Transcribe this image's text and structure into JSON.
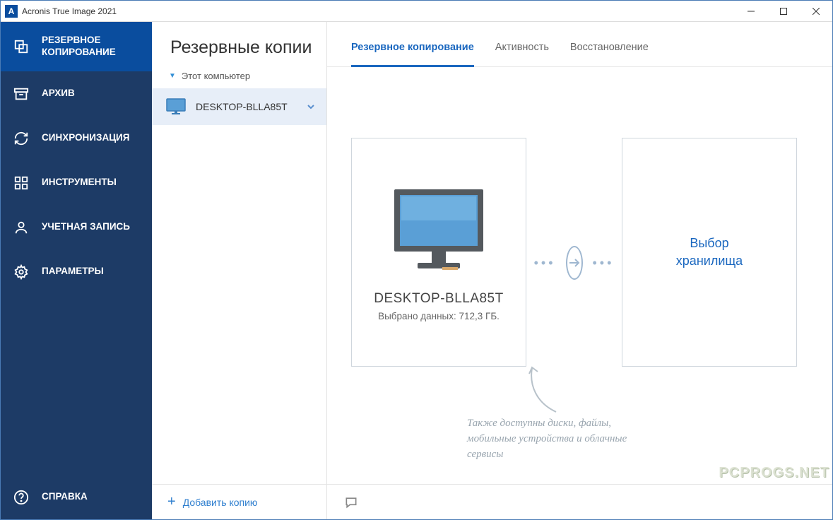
{
  "title": "Acronis True Image 2021",
  "titlebar_icon_letter": "A",
  "nav": {
    "backup": "РЕЗЕРВНОЕ КОПИРОВАНИЕ",
    "archive": "АРХИВ",
    "sync": "СИНХРОНИЗАЦИЯ",
    "tools": "ИНСТРУМЕНТЫ",
    "account": "УЧЕТНАЯ ЗАПИСЬ",
    "settings": "ПАРАМЕТРЫ",
    "help": "СПРАВКА"
  },
  "list": {
    "header": "Резервные копии",
    "group": "Этот компьютер",
    "items": [
      {
        "name": "DESKTOP-BLLA85T"
      }
    ],
    "add": "Добавить копию"
  },
  "tabs": {
    "backup": "Резервное копирование",
    "activity": "Активность",
    "restore": "Восстановление"
  },
  "source": {
    "name": "DESKTOP-BLLA85T",
    "sub": "Выбрано данных: 712,3 ГБ."
  },
  "destination": {
    "label": "Выбор\nхранилища"
  },
  "hint": "Также доступны диски, файлы,\nмобильные устройства и облачные\nсервисы",
  "watermark": "PCPROGS.NET"
}
